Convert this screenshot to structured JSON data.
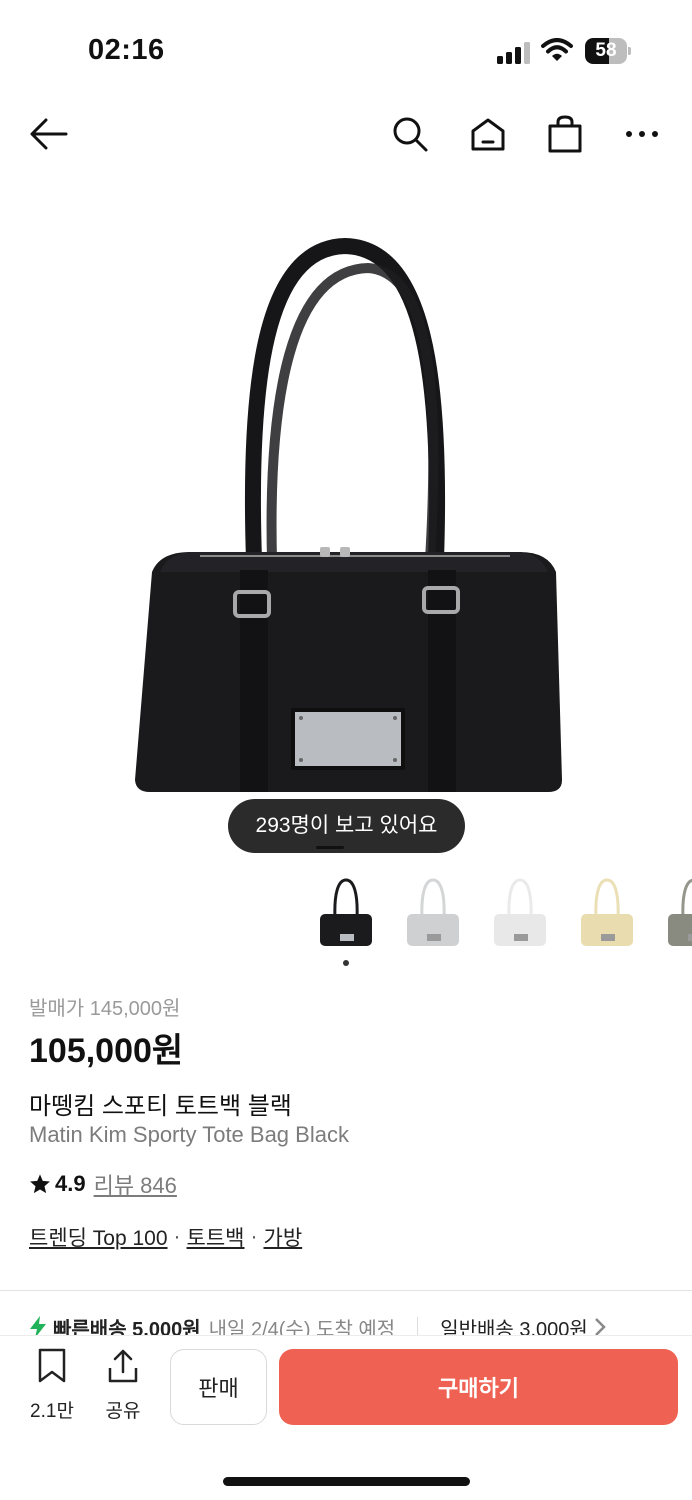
{
  "status_bar": {
    "time": "02:16",
    "battery": "58",
    "battery_level": 0.58
  },
  "nav": {
    "back_icon": "arrow-left-icon",
    "search_icon": "search-icon",
    "home_icon": "home-icon",
    "bag_icon": "shopping-bag-icon",
    "more_icon": "more-horizontal-icon"
  },
  "gallery": {
    "viewers_text": "293명이 보고 있어요",
    "thumbnails": [
      {
        "color_name": "black",
        "color": "#1b1b1e"
      },
      {
        "color_name": "light-grey",
        "color": "#cfd0d2"
      },
      {
        "color_name": "white",
        "color": "#e8e8e8"
      },
      {
        "color_name": "butter",
        "color": "#e9dcae"
      },
      {
        "color_name": "olive-grey",
        "color": "#8a8b80"
      }
    ]
  },
  "product": {
    "original_price": "발매가 145,000원",
    "price": "105,000원",
    "name_ko": "마뗑킴 스포티 토트백 블랙",
    "name_en": "Matin Kim Sporty Tote Bag Black",
    "rating": "4.9",
    "review_label": "리뷰 846",
    "categories": [
      "트렌딩 Top 100",
      "토트백",
      "가방"
    ],
    "category_sep": "·"
  },
  "shipping": {
    "fast_label": "빠른배송 5,000원",
    "fast_eta": "내일 2/4(수) 도착 예정",
    "normal_label": "일반배송 3,000원",
    "accent": "#20b35a"
  },
  "bottom_bar": {
    "wishlist_count": "2.1만",
    "share_label": "공유",
    "sell_label": "판매",
    "buy_label": "구매하기",
    "buy_color": "#ef6253"
  }
}
